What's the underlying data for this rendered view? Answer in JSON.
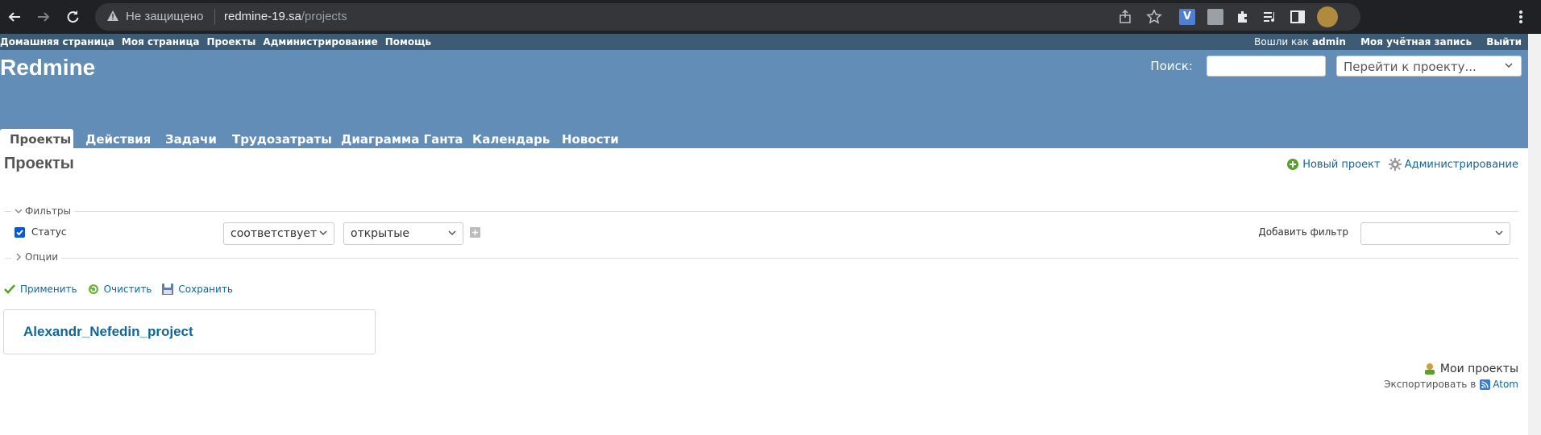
{
  "browser": {
    "security_label": "Не защищено",
    "url_host": "redmine-19.sa",
    "url_path": "/projects"
  },
  "top_menu": {
    "items": [
      "Домашняя страница",
      "Моя страница",
      "Проекты",
      "Администрирование",
      "Помощь"
    ],
    "logged_as_prefix": "Вошли как",
    "logged_as_user": "admin",
    "my_account": "Моя учётная запись",
    "logout": "Выйти"
  },
  "header": {
    "title": "Redmine",
    "search_label": "Поиск:",
    "search_value": "",
    "jump_to_project": "Перейти к проекту..."
  },
  "main_menu": {
    "tabs": [
      "Проекты",
      "Действия",
      "Задачи",
      "Трудозатраты",
      "Диаграмма Ганта",
      "Календарь",
      "Новости"
    ],
    "selected": "Проекты"
  },
  "content": {
    "title": "Проекты",
    "new_project": "Новый проект",
    "administration": "Администрирование",
    "filters_legend": "Фильтры",
    "filter_status_label": "Статус",
    "filter_status_checked": true,
    "filter_operator": "соответствует",
    "filter_value": "открытые",
    "add_filter_label": "Добавить фильтр",
    "add_filter_value": "",
    "options_legend": "Опции",
    "apply": "Применить",
    "clear": "Очистить",
    "save": "Сохранить",
    "projects": [
      "Alexandr_Nefedin_project"
    ],
    "my_projects": "Мои проекты",
    "export_label": "Экспортировать в",
    "atom": "Atom"
  },
  "colors": {
    "header_bg": "#628db6",
    "top_menu_bg": "#3e5b76",
    "link": "#116699"
  }
}
